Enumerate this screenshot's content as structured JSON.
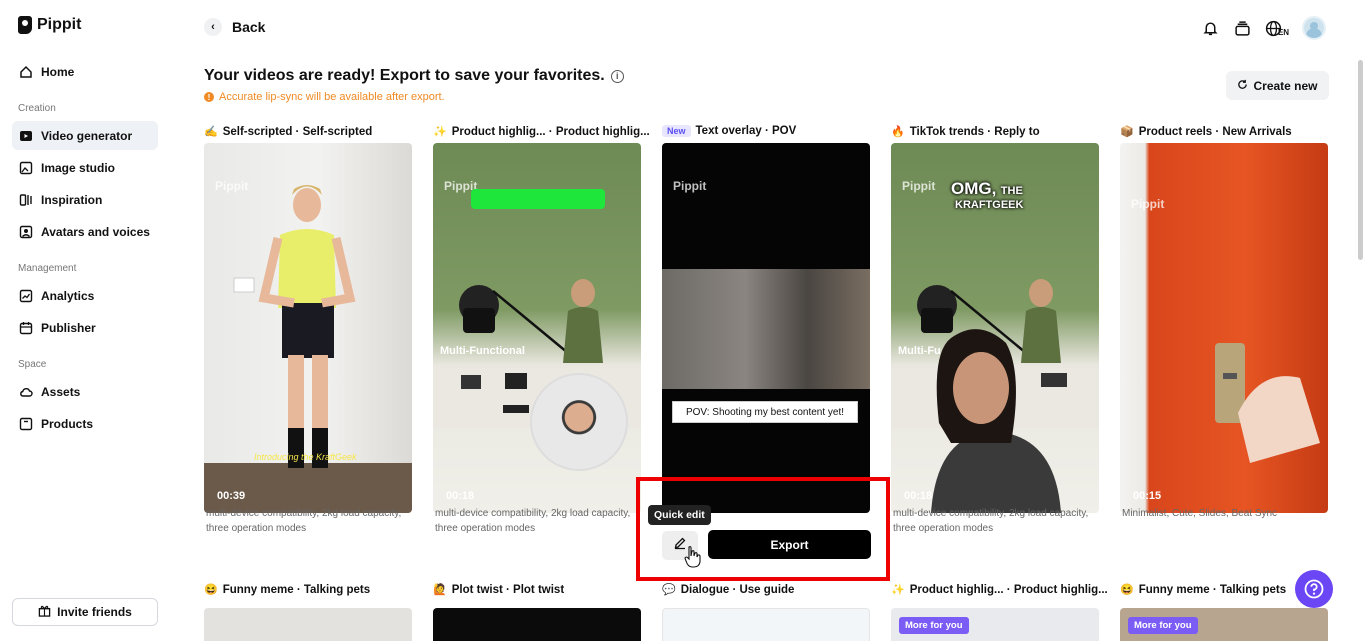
{
  "app": {
    "name": "Pippit"
  },
  "sidebar": {
    "home": "Home",
    "sections": {
      "creation": "Creation",
      "management": "Management",
      "space": "Space"
    },
    "items": {
      "video_generator": "Video generator",
      "image_studio": "Image studio",
      "inspiration": "Inspiration",
      "avatars": "Avatars and voices",
      "analytics": "Analytics",
      "publisher": "Publisher",
      "assets": "Assets",
      "products": "Products"
    },
    "invite": "Invite friends"
  },
  "header": {
    "back": "Back",
    "lang": "EN"
  },
  "main": {
    "title": "Your videos are ready! Export to save your favorites.",
    "notice": "Accurate lip-sync will be available after export.",
    "create_new": "Create new",
    "watermark": "Pippit",
    "cards": [
      {
        "title": "Self-scripted · Self-scripted",
        "duration": "00:39",
        "desc": "multi-device compatibility, 2kg load capacity, three operation modes",
        "caption": "Introducing the KraftGeek"
      },
      {
        "title": "Product highlig... · Product highlig...",
        "duration": "00:18",
        "desc": "multi-device compatibility, 2kg load capacity, three operation modes",
        "overlay": "Multi-Functional"
      },
      {
        "badge": "New",
        "title": "Text overlay · POV",
        "caption": "POV: Shooting my best content yet!"
      },
      {
        "title": "TikTok trends · Reply to",
        "duration": "00:18",
        "desc": "multi-device compatibility, 2kg load capacity, three operation modes",
        "overlay_a": "OMG,",
        "overlay_b": "THE",
        "overlay_c": "KRAFTGEEK",
        "overlay": "Multi-Fu"
      },
      {
        "title": "Product reels · New Arrivals",
        "duration": "00:15",
        "desc": "Minimalist, Cute, Slides, Beat Sync"
      }
    ],
    "quick_edit": "Quick edit",
    "export": "Export",
    "row2": [
      {
        "title": "Funny meme · Talking pets"
      },
      {
        "title": "Plot twist · Plot twist"
      },
      {
        "title": "Dialogue · Use guide"
      },
      {
        "title": "Product highlig... · Product highlig...",
        "badge": "More for you"
      },
      {
        "title": "Funny meme · Talking pets",
        "badge": "More for you"
      }
    ]
  }
}
